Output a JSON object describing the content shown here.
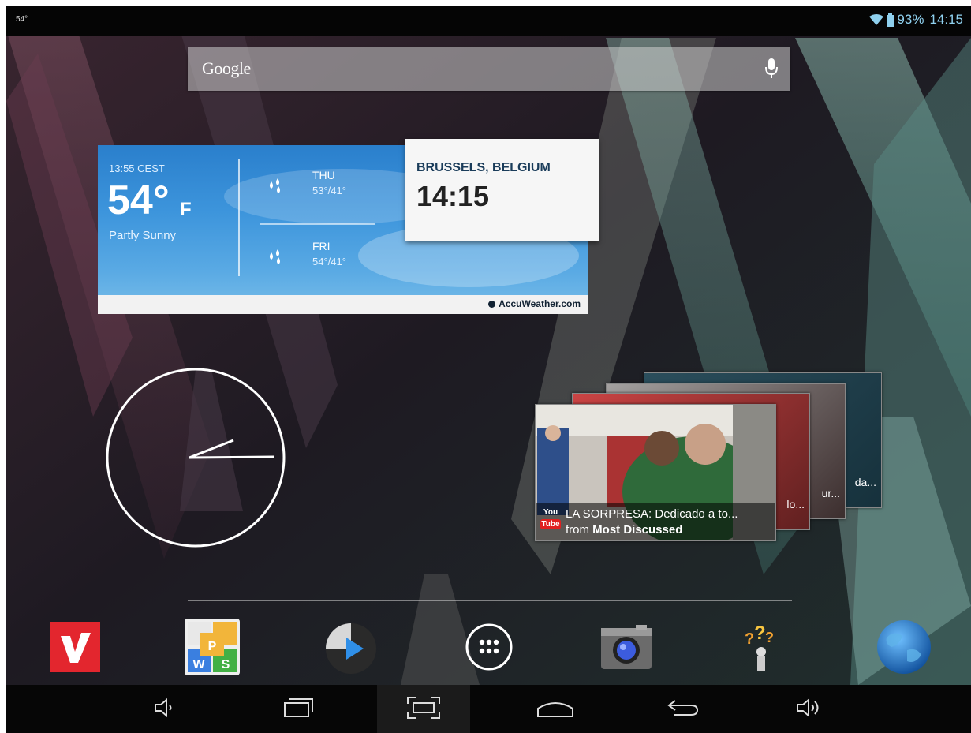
{
  "status_bar": {
    "left_temp": "54°",
    "battery_percent": "93%",
    "time": "14:15",
    "accent_color": "#8fd0ee"
  },
  "search": {
    "logo": "Google",
    "mic_icon": "mic-icon"
  },
  "weather": {
    "local_time": "​13:55 CEST",
    "temperature": "54°",
    "unit": "F",
    "condition": "Partly Sunny",
    "forecast": [
      {
        "day": "THU",
        "range": "53°/41°",
        "icon": "rain-drops-icon"
      },
      {
        "day": "FRI",
        "range": "54°/41°",
        "icon": "rain-drops-icon"
      }
    ],
    "provider": "AccuWeather.com"
  },
  "world_clock": {
    "city": "BRUSSELS, BELGIUM",
    "time": "14:15"
  },
  "youtube_widget": {
    "title": "LA SORPRESA: Dedicado a to...",
    "source_prefix": "from",
    "source": "Most Discussed",
    "back_card_texts": [
      "lo...",
      "ur...",
      "da..."
    ],
    "logo_top": "You",
    "logo_bottom": "Tube"
  },
  "dock": {
    "apps": [
      {
        "name": "vidtrim-app-icon",
        "icon": "v-logo-icon",
        "color": "#e3262e"
      },
      {
        "name": "wordsearch-app-icon",
        "icon": "tiles-icon"
      },
      {
        "name": "media-player-app-icon",
        "icon": "play-icon"
      },
      {
        "name": "all-apps-button",
        "icon": "app-drawer-icon"
      },
      {
        "name": "camera-app-icon",
        "icon": "camera-icon"
      },
      {
        "name": "quiz-app-icon",
        "icon": "question-marks-icon"
      },
      {
        "name": "browser-app-icon",
        "icon": "globe-icon"
      }
    ]
  },
  "navigation": {
    "buttons": [
      "volume-down-icon",
      "recent-apps-icon",
      "screenshot-icon",
      "home-icon",
      "back-icon",
      "volume-up-icon"
    ]
  }
}
